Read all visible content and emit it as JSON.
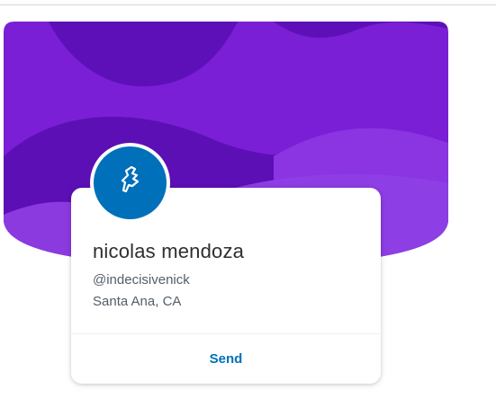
{
  "profile": {
    "name": "nicolas mendoza",
    "handle": "@indecisivenick",
    "location": "Santa Ana, CA",
    "avatar_icon": "paypal-p-icon"
  },
  "actions": {
    "send_label": "Send"
  },
  "colors": {
    "hero_base": "#7a1fd6",
    "hero_dark": "#5a0fb4",
    "hero_light": "#8b3ae0",
    "avatar_bg": "#0070ba",
    "accent": "#0070ba"
  }
}
